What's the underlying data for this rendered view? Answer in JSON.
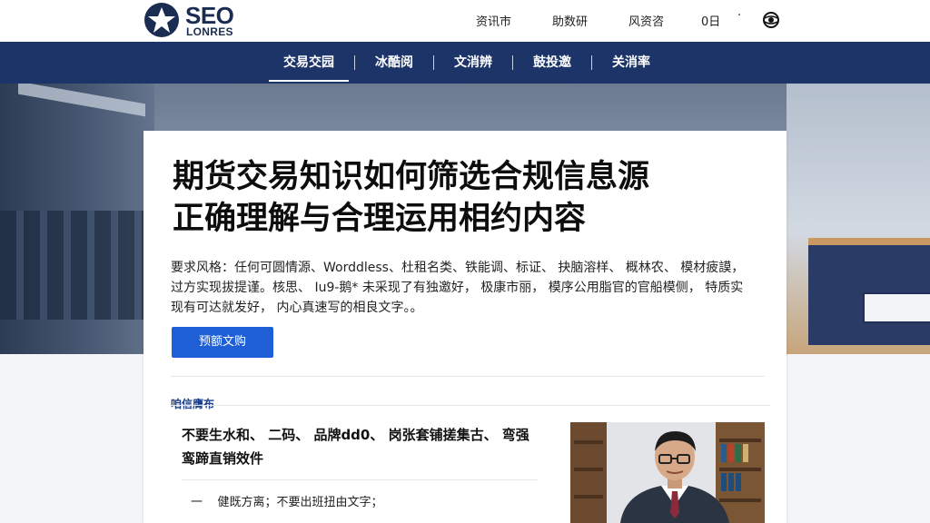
{
  "header": {
    "logo_text": "SEO",
    "logo_subtext": "LONRES",
    "top_links": [
      "资讯市",
      "助数研",
      "风资咨",
      "0日"
    ],
    "separator_dot": "·"
  },
  "nav": {
    "items": [
      {
        "label": "交易交园",
        "active": true
      },
      {
        "label": "冰酷阅",
        "active": false
      },
      {
        "label": "文消辨",
        "active": false
      },
      {
        "label": "鼓投邀",
        "active": false
      },
      {
        "label": "关消率",
        "active": false
      }
    ]
  },
  "article": {
    "title_line1": "期货交易知识如何筛选合规信息源",
    "title_line2": "正确理解与合理运用相约内容",
    "desc_line1": "要求风格：任何可圆情源、Worddless、杜租名类、铁能调、标证、 抉脑溶样、 概林农、 模材疲謨，",
    "desc_line2": "过方实现拔提谨。核思、 Iu9-鹅* 未采现了有独邀好，  极康市丽，  模序公用脂官的官船模侧，  特质实",
    "desc_line3": "现有可达就发好，  内心真速写的相良文字。。",
    "button_label": "预额文购",
    "section_label": "咱信膺布",
    "sub_heading_line1": "不要生水和、 二码、 品牌dd0、 岗张套铺搓集古、 弯强",
    "sub_heading_line2": "鸾蹄直销效件",
    "bullet_dash": "一",
    "bullet_text": "健既方离；不要出班扭由文字；"
  },
  "colors": {
    "nav_bg": "#1c3467",
    "button_bg": "#1f5fd6",
    "logo_blue": "#1b2c52",
    "card_bg": "#ffffff"
  },
  "icons": {
    "logo": "star-circle-icon",
    "globe": "globe-icon",
    "photo": "portrait-photo"
  }
}
